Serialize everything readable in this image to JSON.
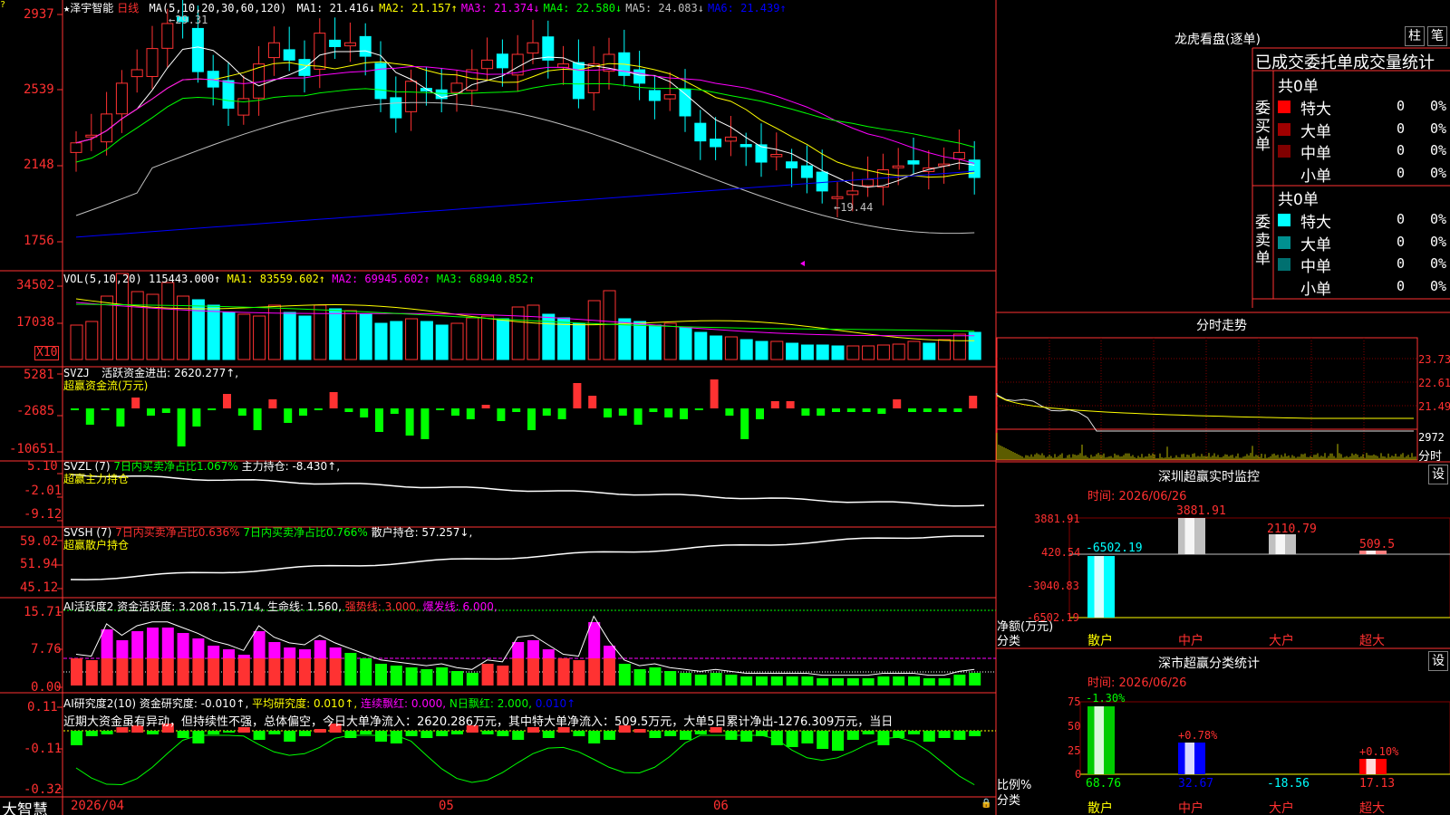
{
  "stock": {
    "name": "泽宇智能",
    "period": "日线"
  },
  "main_panel": {
    "ma_label": "MA(5,10,20,30,60,120)",
    "ma_values": [
      "MA1: 21.416↓",
      "MA2: 21.157↑",
      "MA3: 21.374↓",
      "MA4: 22.580↓",
      "MA5: 24.083↓",
      "MA6: 21.439↑"
    ],
    "ma_colors": [
      "#ffffff",
      "#ffff00",
      "#ff00ff",
      "#00ff00",
      "#c0c0c0",
      "#0000ff"
    ],
    "y_ticks": [
      "2937",
      "2539",
      "2148",
      "1756"
    ],
    "high_note": "29.31",
    "low_note": "←19.44"
  },
  "vol_panel": {
    "label": "VOL(5,10,20)",
    "value": "115443.000↑",
    "ma1": "MA1: 83559.602↑",
    "ma2": "MA2: 69945.602↑",
    "ma3": "MA3: 68940.852↑",
    "y_ticks": [
      "34502",
      "17038"
    ],
    "unit": "X10"
  },
  "svzj_panel": {
    "label": "SVZJ",
    "value": "活跃资金进出: 2620.277↑,",
    "subtitle": "超赢资金流(万元)",
    "y_ticks": [
      "5281",
      "-2685",
      "-10651"
    ]
  },
  "svzl_panel": {
    "label": "SVZL (7)",
    "green": "7日内买卖净占比1.067%",
    "value": "主力持仓: -8.430↑,",
    "subtitle": "超赢主力持仓",
    "y_ticks": [
      "5.10",
      "-2.01",
      "-9.12"
    ]
  },
  "svsh_panel": {
    "label": "SVSH (7)",
    "red": "7日内买卖净占比0.636%",
    "green": "7日内买卖净占比0.766%",
    "value": "散户持仓: 57.257↓,",
    "subtitle": "超赢散户持仓",
    "y_ticks": [
      "59.02",
      "51.94",
      "45.12"
    ]
  },
  "ai_active_panel": {
    "label": "AI活跃度2",
    "value": "资金活跃度: 3.208↑,15.714,",
    "life": "生命线: 1.560,",
    "strong": "强势线: 3.000,",
    "burst": "爆发线: 6.000,",
    "y_ticks": [
      "15.71",
      "7.76",
      "0.00"
    ]
  },
  "ai_research_panel": {
    "label": "AI研究度2(10)",
    "value": "资金研究度: -0.010↑,",
    "avg": "平均研究度: 0.010↑,",
    "red": "连续飘红: 0.000,",
    "nday": "N日飘红: 2.000,",
    "tail": "0.010↑",
    "comment": "近期大资金虽有异动，但持续性不强，总体偏空，今日大单净流入：2620.286万元，其中特大单净流入：509.5万元，大单5日累计净出-1276.309万元，当日",
    "y_ticks": [
      "0.11",
      "-0.11",
      "-0.32"
    ]
  },
  "bottom_axis": {
    "brand": "大智慧",
    "start": "2026/04",
    "m5": "05",
    "m6": "06"
  },
  "right_panel": {
    "dragon_title": "龙虎看盘(逐单)",
    "tab1": "柱",
    "tab2": "笔",
    "stats_title": "已成交委托单成交量统计",
    "buy_group": "委买单",
    "sell_group": "委卖单",
    "buy_total": "共0单",
    "sell_total": "共0单",
    "rows": [
      "特大",
      "大单",
      "中单",
      "小单"
    ],
    "buy_colors": [
      "#ff0000",
      "#a00000",
      "#800000",
      "#000000"
    ],
    "sell_colors": [
      "#00ffff",
      "#009090",
      "#007070",
      "#000000"
    ],
    "count": "0",
    "pct": "0%",
    "intraday_title": "分时走势",
    "intraday_ticks": [
      "23.73",
      "22.61",
      "21.49",
      "2972",
      "分时"
    ],
    "monitor_title": "深圳超赢实时监控",
    "monitor_set": "设",
    "monitor_time": "时间: 2026/06/26",
    "monitor_ticks": [
      "3881.91",
      "420.54",
      "-3040.83",
      "-6502.19"
    ],
    "monitor_values": [
      "-6502.19",
      "3881.91",
      "2110.79",
      "509.5"
    ],
    "monitor_ylabel": "净额(万元)",
    "monitor_xlabel": "分类",
    "categories": [
      "散户",
      "中户",
      "大户",
      "超大"
    ],
    "class_title": "深市超赢分类统计",
    "class_set": "设",
    "class_time": "时间: 2026/06/26",
    "class_ticks": [
      "75",
      "50",
      "25",
      "0"
    ],
    "class_bar_labels": [
      "-1.30%",
      "+0.78%",
      "+0.10%"
    ],
    "class_values": [
      "68.76",
      "32.67",
      "-18.56",
      "17.13"
    ],
    "class_ylabel": "比例%",
    "class_xlabel": "分类"
  }
}
